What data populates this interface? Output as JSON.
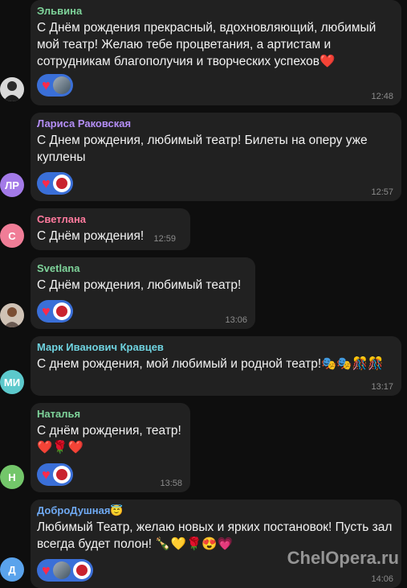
{
  "messages": [
    {
      "sender": "Эльвина",
      "sender_color": "#7ed39a",
      "text": "С Днём рождения прекрасный, вдохновляющий, любимый  мой  театр! Желаю тебе процветания, а артистам и сотрудникам благополучия и творческих успехов❤️",
      "time": "12:48",
      "reaction": "heart-icon"
    },
    {
      "sender": "Лариса Раковская",
      "sender_color": "#b48ef6",
      "avatar_initials": "ЛР",
      "avatar_color": "#a37ae8",
      "text": "С Днем рождения, любимый театр! Билеты на оперу уже куплены",
      "time": "12:57",
      "reaction": "heart-icon"
    },
    {
      "sender": "Светлана",
      "sender_color": "#ff7a9d",
      "avatar_initials": "С",
      "avatar_color": "#f07d97",
      "text": "С Днём рождения!",
      "time": "12:59"
    },
    {
      "sender": "Svetlana",
      "sender_color": "#7ed39a",
      "text": "С Днём рождения, любимый театр!",
      "time": "13:06",
      "reaction": "heart-icon"
    },
    {
      "sender": "Марк Иванович Кравцев",
      "sender_color": "#6fd3e0",
      "avatar_initials": "МИ",
      "avatar_color": "#5cc9cc",
      "text": "С днем рождения, мой любимый и родной театр!🎭🎭🎊🎊",
      "time": "13:17"
    },
    {
      "sender": "Наталья",
      "sender_color": "#7ed39a",
      "avatar_initials": "Н",
      "avatar_color": "#73c66a",
      "text": "С днём рождения, театр!",
      "text2": "❤️🌹❤️",
      "time": "13:58",
      "reaction": "heart-icon"
    },
    {
      "sender": "ДоброДушная😇",
      "sender_color": "#6fa9f2",
      "avatar_initials": "Д",
      "avatar_color": "#5aa3ec",
      "text": "Любимый Театр, желаю новых и ярких постановок! Пусть зал всегда будет полон! 🍾💛🌹😍💗",
      "time": "14:06",
      "reaction": "heart-icon"
    }
  ],
  "watermark": "ChelOpera.ru"
}
